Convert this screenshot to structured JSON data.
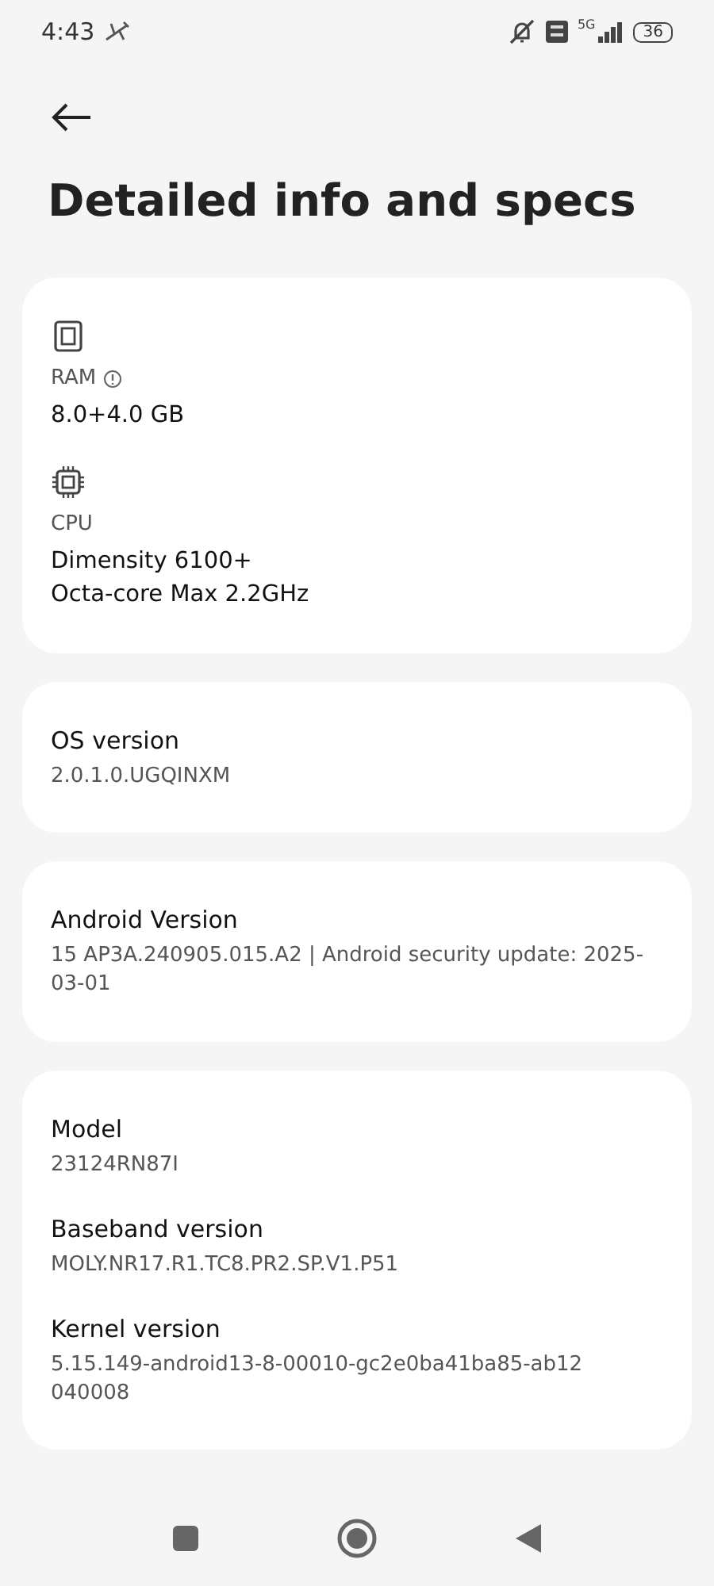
{
  "status_bar": {
    "time": "4:43",
    "network": "5G",
    "battery": "36"
  },
  "title": "Detailed info and specs",
  "cards": [
    {
      "items": [
        {
          "kind": "memory",
          "label": "RAM",
          "info_icon": true,
          "value": "8.0+4.0 GB"
        },
        {
          "kind": "processor",
          "label": "CPU",
          "info_icon": false,
          "value": "Dimensity 6100+\nOcta-core Max 2.2GHz"
        }
      ]
    },
    {
      "items": [
        {
          "label": "OS version",
          "value": "2.0.1.0.UGQINXM"
        }
      ]
    },
    {
      "items": [
        {
          "label": "Android Version",
          "value": "15 AP3A.240905.015.A2 | Android security update: 2025-03-01"
        }
      ]
    },
    {
      "items": [
        {
          "label": "Model",
          "value": "23124RN87I"
        },
        {
          "label": "Baseband version",
          "value": "MOLY.NR17.R1.TC8.PR2.SP.V1.P51"
        },
        {
          "label": "Kernel version",
          "value": "5.15.149-android13-8-00010-gc2e0ba41ba85-ab12 040008"
        }
      ]
    }
  ]
}
